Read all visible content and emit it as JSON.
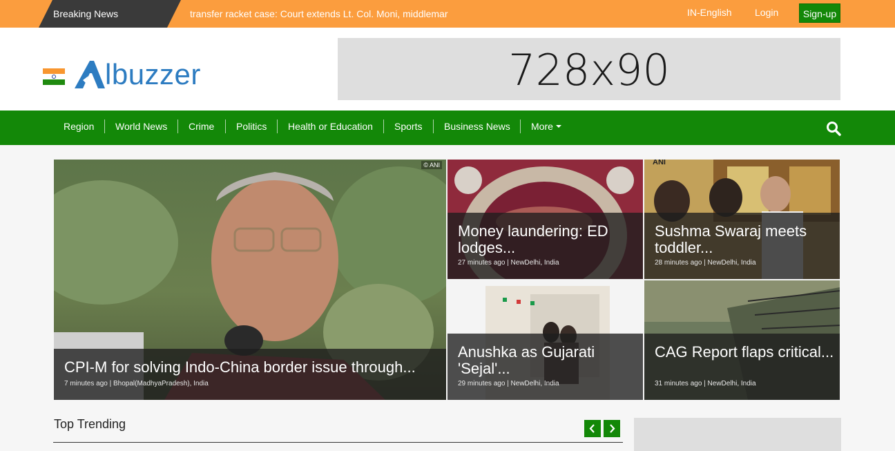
{
  "topbar": {
    "breaking_label": "Breaking News",
    "ticker": "transfer racket case: Court extends Lt. Col. Moni, middlemar",
    "language": "IN-English",
    "login": "Login",
    "signup": "Sign-up"
  },
  "header": {
    "logo_letter": "A",
    "logo_text": "lbuzzer",
    "ad_text": "728x90"
  },
  "nav": {
    "items": [
      "Region",
      "World News",
      "Crime",
      "Politics",
      "Health or Education",
      "Sports",
      "Business News",
      "More"
    ]
  },
  "stories": [
    {
      "title": "CPI-M for solving Indo-China border issue through...",
      "meta": "7 minutes ago | Bhopal(MadhyaPradesh), India",
      "badge": "© ANI"
    },
    {
      "title": "Money laundering: ED lodges...",
      "meta": "27 minutes ago | NewDelhi, India"
    },
    {
      "title": "Sushma Swaraj meets toddler...",
      "meta": "28 minutes ago | NewDelhi, India",
      "badge": "ANI"
    },
    {
      "title": "Anushka as Gujarati 'Sejal'...",
      "meta": "29 minutes ago | NewDelhi, India"
    },
    {
      "title": "CAG Report flaps critical...",
      "meta": "31 minutes ago | NewDelhi, India"
    }
  ],
  "trending": {
    "title": "Top Trending"
  },
  "colors": {
    "topbar": "#fb9d3e",
    "nav": "#138808",
    "brand": "#2d7cc1"
  }
}
